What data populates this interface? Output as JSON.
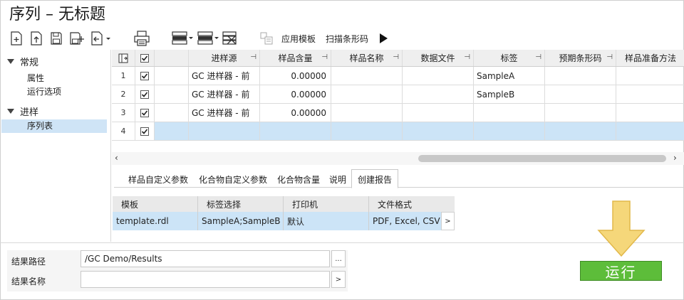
{
  "window": {
    "title": "序列 – 无标题"
  },
  "toolbar": {
    "apply_template_label": "应用模板",
    "scan_barcode_label": "扫描条形码"
  },
  "nav": {
    "groups": [
      {
        "label": "常规",
        "items": [
          "属性",
          "运行选项"
        ]
      },
      {
        "label": "进样",
        "items": [
          "序列表"
        ]
      }
    ]
  },
  "grid": {
    "columns": [
      "进样源",
      "样品含量",
      "样品名称",
      "数据文件",
      "标签",
      "预期条形码",
      "样品准备方法"
    ],
    "rows": [
      {
        "num": "1",
        "checked": true,
        "source": "GC 进样器 - 前",
        "amount": "0.00000",
        "name": "",
        "datafile": "",
        "label": "SampleA",
        "barcode": "",
        "prep": ""
      },
      {
        "num": "2",
        "checked": true,
        "source": "GC 进样器 - 前",
        "amount": "0.00000",
        "name": "",
        "datafile": "",
        "label": "SampleB",
        "barcode": "",
        "prep": ""
      },
      {
        "num": "3",
        "checked": true,
        "source": "GC 进样器 - 前",
        "amount": "0.00000",
        "name": "",
        "datafile": "",
        "label": "",
        "barcode": "",
        "prep": ""
      },
      {
        "num": "4",
        "checked": true,
        "source": "",
        "amount": "",
        "name": "",
        "datafile": "",
        "label": "",
        "barcode": "",
        "prep": ""
      }
    ]
  },
  "tabs": [
    "样品自定义参数",
    "化合物自定义参数",
    "化合物含量",
    "说明",
    "创建报告"
  ],
  "active_tab": "创建报告",
  "report_table": {
    "columns": [
      "模板",
      "标签选择",
      "打印机",
      "文件格式"
    ],
    "rows": [
      {
        "template": "template.rdl",
        "labels": "SampleA;SampleB",
        "printer": "默认",
        "format": "PDF, Excel, CSV"
      }
    ],
    "more_label": ">"
  },
  "result": {
    "path_label": "结果路径",
    "path_value": "/GC Demo/Results",
    "path_btn": "...",
    "name_label": "结果名称",
    "name_value": "",
    "name_btn": ">"
  },
  "run_button": {
    "label": "运行"
  },
  "colors": {
    "run_green": "#5dbd3a",
    "selection_blue": "#cce4f7",
    "hint_arrow": "#f5d77a"
  }
}
